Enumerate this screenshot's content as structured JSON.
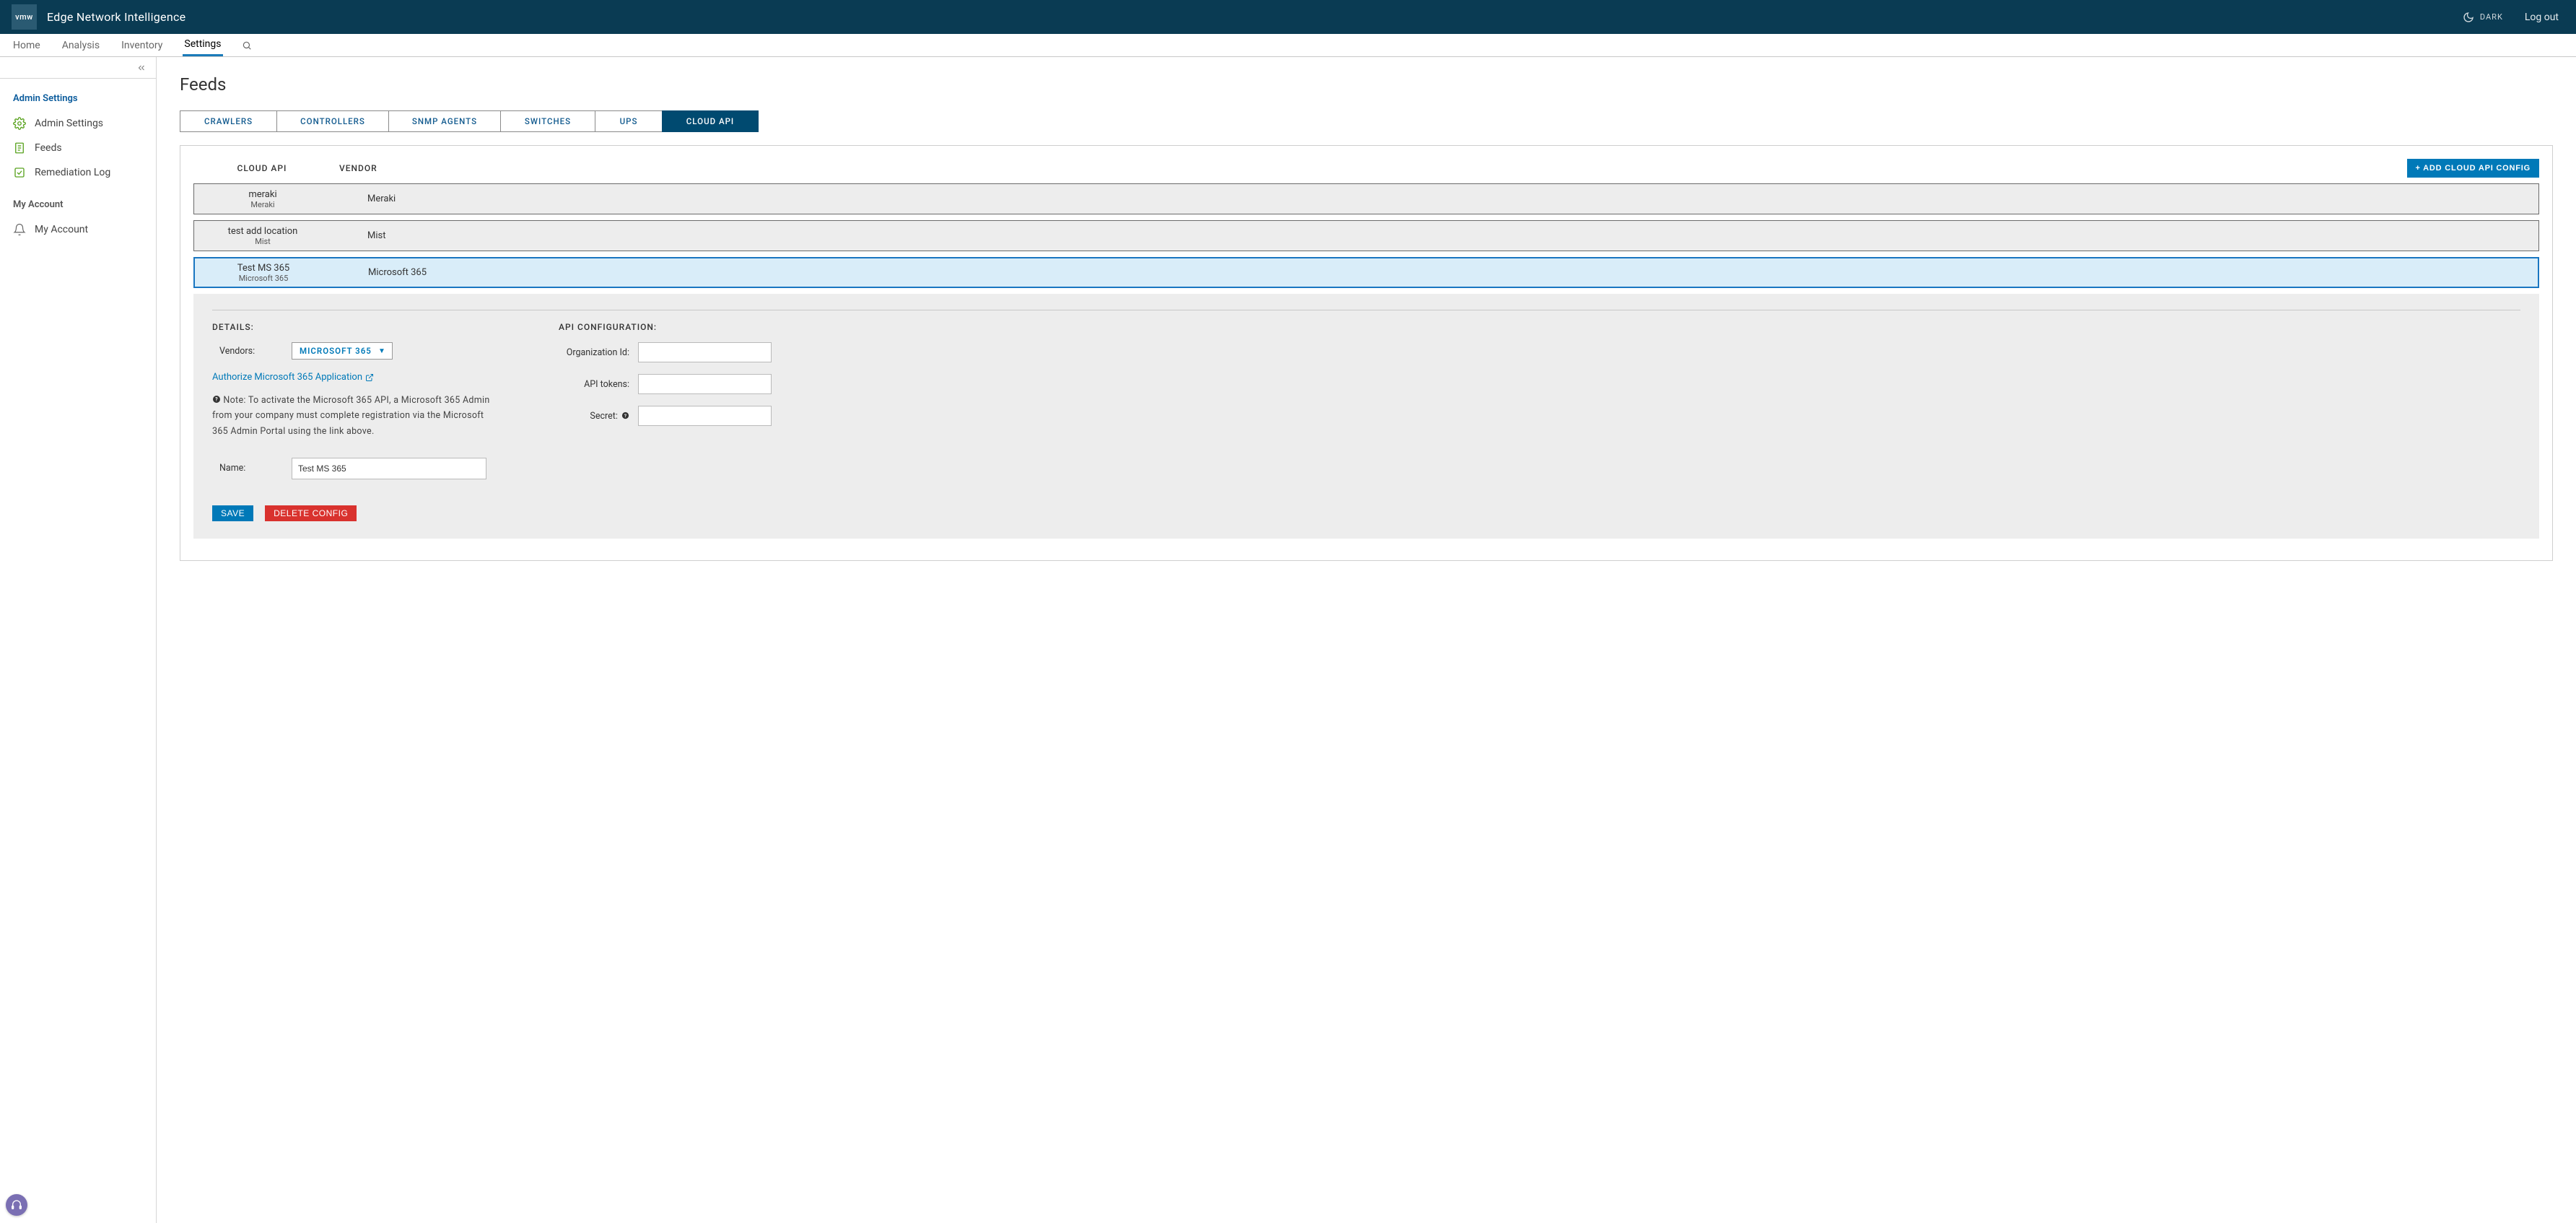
{
  "header": {
    "logo_text": "vmw",
    "title": "Edge Network Intelligence",
    "dark_label": "DARK",
    "logout_label": "Log out"
  },
  "nav": {
    "items": [
      {
        "label": "Home",
        "active": false
      },
      {
        "label": "Analysis",
        "active": false
      },
      {
        "label": "Inventory",
        "active": false
      },
      {
        "label": "Settings",
        "active": true
      }
    ]
  },
  "sidebar": {
    "sections": [
      {
        "title": "Admin Settings",
        "style": "primary",
        "items": [
          {
            "label": "Admin Settings",
            "icon": "gear"
          },
          {
            "label": "Feeds",
            "icon": "doc"
          },
          {
            "label": "Remediation Log",
            "icon": "check-square"
          }
        ]
      },
      {
        "title": "My Account",
        "style": "muted",
        "items": [
          {
            "label": "My Account",
            "icon": "bell"
          }
        ]
      }
    ]
  },
  "page": {
    "title": "Feeds",
    "tabs": [
      {
        "label": "CRAWLERS",
        "active": false
      },
      {
        "label": "CONTROLLERS",
        "active": false
      },
      {
        "label": "SNMP AGENTS",
        "active": false
      },
      {
        "label": "SWITCHES",
        "active": false
      },
      {
        "label": "UPS",
        "active": false
      },
      {
        "label": "CLOUD API",
        "active": true
      }
    ],
    "table": {
      "headers": {
        "api": "CLOUD API",
        "vendor": "VENDOR"
      },
      "add_button": "+ ADD CLOUD API CONFIG",
      "rows": [
        {
          "name": "meraki",
          "sub": "Meraki",
          "vendor": "Meraki",
          "selected": false
        },
        {
          "name": "test add location",
          "sub": "Mist",
          "vendor": "Mist",
          "selected": false
        },
        {
          "name": "Test MS 365",
          "sub": "Microsoft 365",
          "vendor": "Microsoft 365",
          "selected": true
        }
      ]
    },
    "details": {
      "sections": {
        "left_title": "DETAILS:",
        "right_title": "API CONFIGURATION:"
      },
      "vendors_label": "Vendors:",
      "vendors_value": "MICROSOFT 365",
      "authorize_link": "Authorize Microsoft 365 Application",
      "note": "Note: To activate the Microsoft 365 API, a Microsoft 365 Admin from your company must complete registration via the Microsoft 365 Admin Portal using the link above.",
      "name_label": "Name:",
      "name_value": "Test MS 365",
      "org_label": "Organization Id:",
      "org_value": "",
      "tokens_label": "API tokens:",
      "tokens_value": "",
      "secret_label": "Secret:",
      "secret_value": "",
      "save_label": "SAVE",
      "delete_label": "DELETE CONFIG"
    }
  }
}
